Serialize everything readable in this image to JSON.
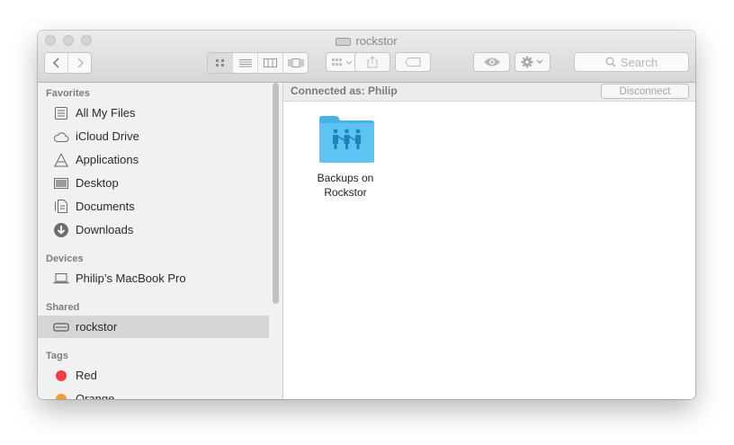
{
  "window": {
    "title": "rockstor"
  },
  "toolbar": {
    "search_placeholder": "Search"
  },
  "sidebar": {
    "sections": {
      "favorites": "Favorites",
      "devices": "Devices",
      "shared": "Shared",
      "tags": "Tags"
    },
    "favorites": [
      {
        "label": "All My Files",
        "icon": "all-my-files-icon"
      },
      {
        "label": "iCloud Drive",
        "icon": "cloud-icon"
      },
      {
        "label": "Applications",
        "icon": "applications-icon"
      },
      {
        "label": "Desktop",
        "icon": "desktop-icon"
      },
      {
        "label": "Documents",
        "icon": "documents-icon"
      },
      {
        "label": "Downloads",
        "icon": "downloads-icon"
      }
    ],
    "devices": [
      {
        "label": "Philip’s MacBook Pro",
        "icon": "laptop-icon"
      }
    ],
    "shared": [
      {
        "label": "rockstor",
        "icon": "server-icon",
        "selected": true
      }
    ],
    "tags": [
      {
        "label": "Red",
        "color": "#f23c42"
      },
      {
        "label": "Orange",
        "color": "#f79a2b"
      }
    ]
  },
  "content": {
    "connected_as": "Connected as: Philip",
    "disconnect_label": "Disconnect",
    "items": [
      {
        "label_line1": "Backups on",
        "label_line2": "Rockstor",
        "icon": "shared-folder-icon"
      }
    ]
  },
  "colors": {
    "folder_blue": "#5cc3f2",
    "selection_gray": "#d5d5d5"
  }
}
